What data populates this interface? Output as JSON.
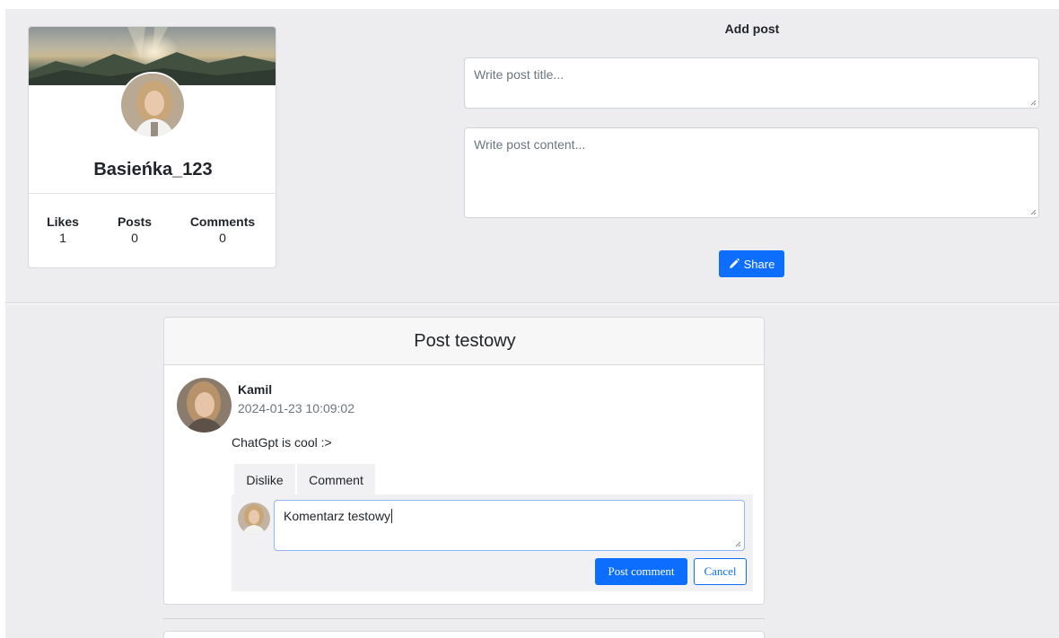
{
  "profile": {
    "username": "Basieńka_123",
    "stats": [
      {
        "label": "Likes",
        "value": "1"
      },
      {
        "label": "Posts",
        "value": "0"
      },
      {
        "label": "Comments",
        "value": "0"
      }
    ]
  },
  "add_post": {
    "title": "Add post",
    "title_placeholder": "Write post title...",
    "content_placeholder": "Write post content...",
    "share_label": "Share"
  },
  "post": {
    "title": "Post testowy",
    "author": "Kamil",
    "timestamp": "2024-01-23 10:09:02",
    "body": "ChatGpt is cool :>",
    "tabs": [
      "Dislike",
      "Comment"
    ],
    "comment_value": "Komentarz testowy",
    "post_comment_label": "Post comment",
    "cancel_label": "Cancel"
  },
  "colors": {
    "primary": "#0d6efd",
    "background": "#ededf0"
  }
}
